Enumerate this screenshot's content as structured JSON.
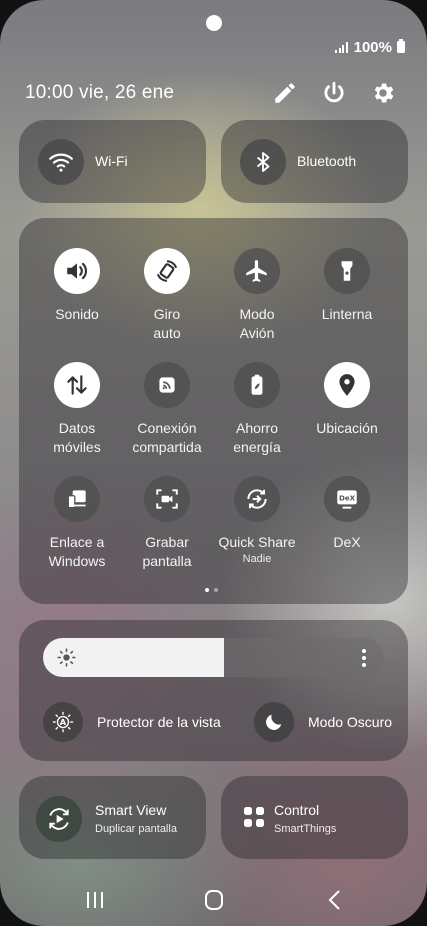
{
  "status_bar": {
    "battery_text": "100%"
  },
  "header": {
    "datetime": "10:00  vie, 26 ene"
  },
  "toggles": {
    "wifi": "Wi-Fi",
    "bluetooth": "Bluetooth"
  },
  "quick_settings": [
    {
      "line1": "Sonido",
      "line2": "",
      "sub": "",
      "on": true,
      "icon": "sound-icon"
    },
    {
      "line1": "Giro",
      "line2": "auto",
      "sub": "",
      "on": true,
      "icon": "auto-rotate-icon"
    },
    {
      "line1": "Modo",
      "line2": "Avión",
      "sub": "",
      "on": false,
      "icon": "airplane-icon"
    },
    {
      "line1": "Linterna",
      "line2": "",
      "sub": "",
      "on": false,
      "icon": "flashlight-icon"
    },
    {
      "line1": "Datos",
      "line2": "móviles",
      "sub": "",
      "on": true,
      "icon": "mobile-data-icon"
    },
    {
      "line1": "Conexión",
      "line2": "compartida",
      "sub": "",
      "on": false,
      "icon": "hotspot-icon"
    },
    {
      "line1": "Ahorro",
      "line2": "energía",
      "sub": "",
      "on": false,
      "icon": "power-saving-icon"
    },
    {
      "line1": "Ubicación",
      "line2": "",
      "sub": "",
      "on": true,
      "icon": "location-icon"
    },
    {
      "line1": "Enlace a",
      "line2": "Windows",
      "sub": "",
      "on": false,
      "icon": "link-windows-icon"
    },
    {
      "line1": "Grabar",
      "line2": "pantalla",
      "sub": "",
      "on": false,
      "icon": "screen-record-icon"
    },
    {
      "line1": "Quick Share",
      "line2": "",
      "sub": "Nadie",
      "on": false,
      "icon": "quick-share-icon"
    },
    {
      "line1": "DeX",
      "line2": "",
      "sub": "",
      "on": false,
      "icon": "dex-icon"
    }
  ],
  "pager": {
    "pages": 2,
    "current": 1
  },
  "brightness": {
    "level": 0.53
  },
  "eye_comfort": "Protector de la vista",
  "dark_mode": "Modo Oscuro",
  "smart_view": {
    "title": "Smart View",
    "subtitle": "Duplicar pantalla"
  },
  "smartthings": {
    "title": "Control",
    "subtitle": "SmartThings"
  },
  "colors": {
    "tile_bg": "#28262a",
    "active_circle": "#ffffff"
  }
}
